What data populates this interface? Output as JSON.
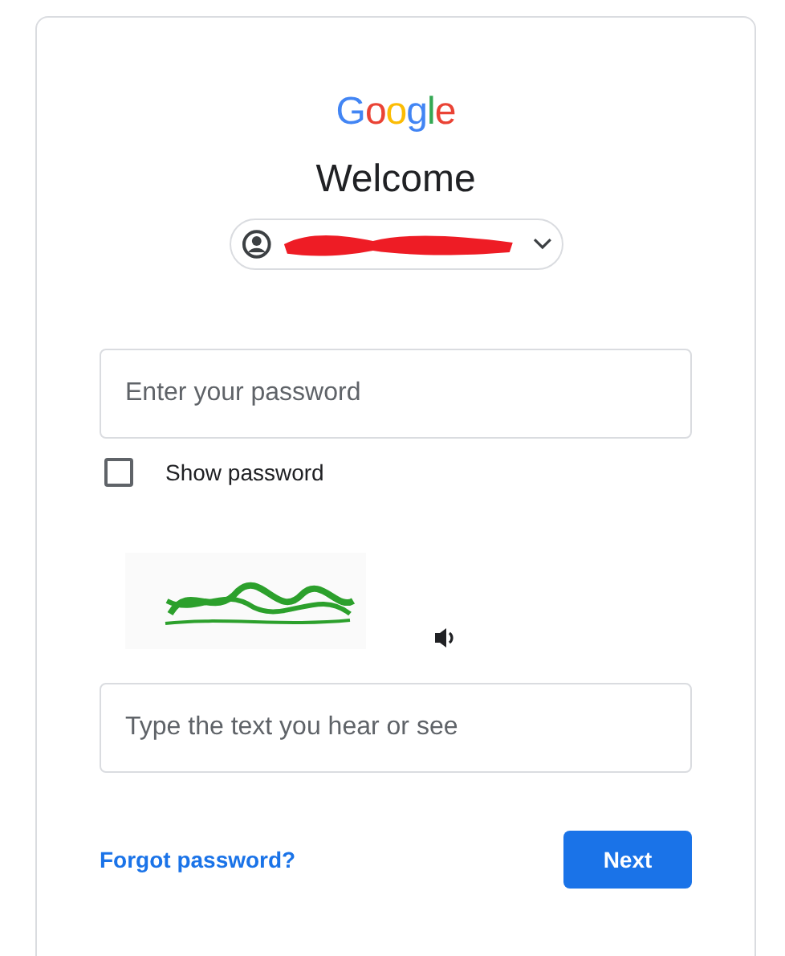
{
  "logo": {
    "letters": [
      {
        "char": "G",
        "color": "#4285f4"
      },
      {
        "char": "o",
        "color": "#ea4335"
      },
      {
        "char": "o",
        "color": "#fbbc05"
      },
      {
        "char": "g",
        "color": "#4285f4"
      },
      {
        "char": "l",
        "color": "#34a853"
      },
      {
        "char": "e",
        "color": "#ea4335"
      }
    ]
  },
  "heading": "Welcome",
  "account_chip": {
    "redacted": true
  },
  "password_field": {
    "placeholder": "Enter your password"
  },
  "show_password": {
    "label": "Show password",
    "checked": false
  },
  "captcha_field": {
    "placeholder": "Type the text you hear or see"
  },
  "forgot_link": "Forgot password?",
  "next_button": "Next"
}
